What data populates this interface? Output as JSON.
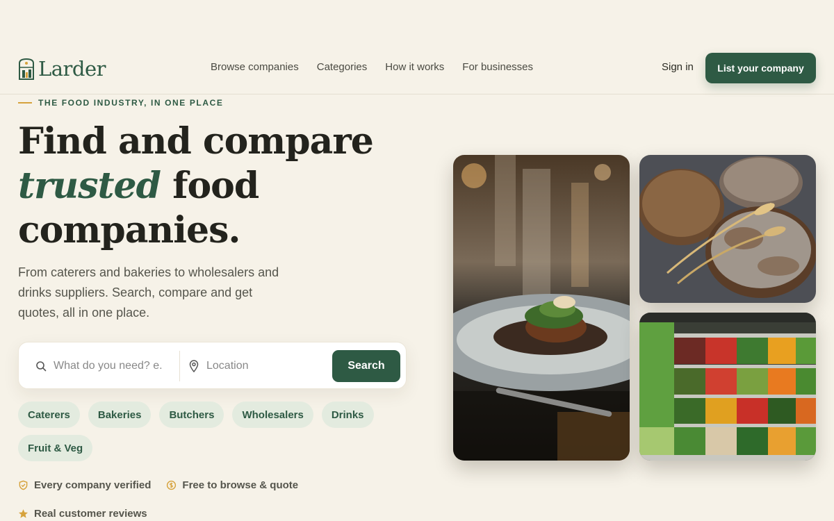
{
  "brand": {
    "name": "Larder"
  },
  "nav": {
    "items": [
      {
        "label": "Browse companies"
      },
      {
        "label": "Categories"
      },
      {
        "label": "How it works"
      },
      {
        "label": "For businesses"
      }
    ],
    "sign_in": "Sign in",
    "cta": "List your company"
  },
  "hero": {
    "eyebrow": "THE FOOD INDUSTRY, IN ONE PLACE",
    "headline_1": "Find and compare",
    "headline_accent": "trusted",
    "headline_2": "food",
    "headline_3": "companies.",
    "subtext": "From caterers and bakeries to wholesalers and drinks suppliers. Search, compare and get quotes, all in one place."
  },
  "search": {
    "query_placeholder": "What do you need? e.",
    "location_placeholder": "Location",
    "button": "Search"
  },
  "categories": [
    {
      "label": "Caterers"
    },
    {
      "label": "Bakeries"
    },
    {
      "label": "Butchers"
    },
    {
      "label": "Wholesalers"
    },
    {
      "label": "Drinks"
    },
    {
      "label": "Fruit & Veg"
    }
  ],
  "trust": [
    {
      "label": "Every company verified",
      "icon": "shield-check-icon"
    },
    {
      "label": "Free to browse & quote",
      "icon": "coin-icon"
    },
    {
      "label": "Real customer reviews",
      "icon": "star-icon"
    }
  ],
  "colors": {
    "background": "#f6f2e8",
    "brand_green": "#2e5a44",
    "accent_gold": "#d6a23c",
    "chip_bg": "#e3ebdf"
  }
}
